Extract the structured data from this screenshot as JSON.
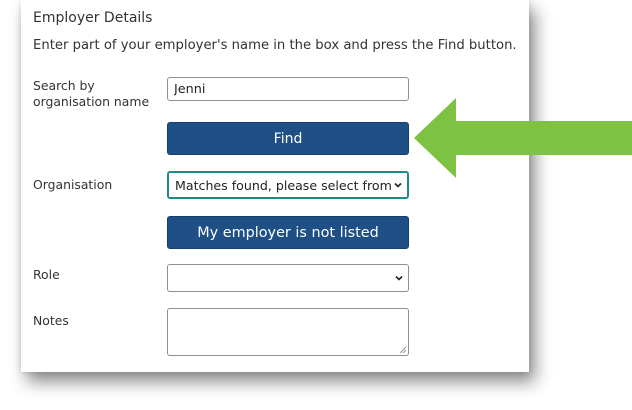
{
  "section_title": "Employer Details",
  "instructions": "Enter part of your employer's name in the box and press the Find button.",
  "search": {
    "label_line1": "Search by",
    "label_line2": "organisation name",
    "value": "Jenni"
  },
  "find_button": {
    "label": "Find"
  },
  "organisation": {
    "label": "Organisation",
    "selected": "Matches found, please select from list"
  },
  "not_listed_button": {
    "label": "My employer is not listed"
  },
  "role": {
    "label": "Role",
    "selected": ""
  },
  "notes": {
    "label": "Notes",
    "value": ""
  },
  "colors": {
    "button": "#1e4f85",
    "focus": "#1f8a8a",
    "arrow": "#7dc242"
  },
  "icons": [
    "chevron-down-icon",
    "resize-grip-icon",
    "arrow-left-icon"
  ]
}
